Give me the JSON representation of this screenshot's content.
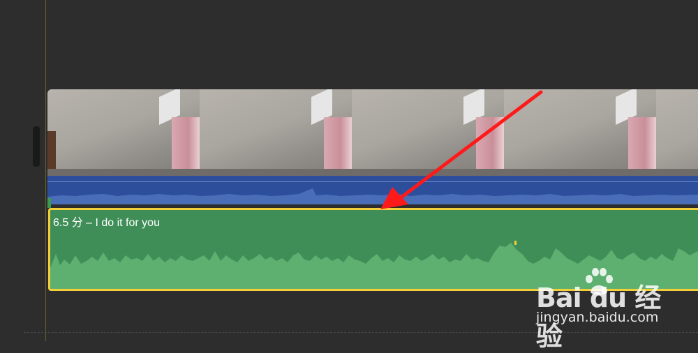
{
  "timeline": {
    "video_clip": {
      "thumbnail_count": 5
    },
    "music_clip": {
      "title": "6.5 分 – I do it for you",
      "selected": true
    }
  },
  "annotation": {
    "arrow_color": "#ff1a1a"
  },
  "watermark": {
    "logo": "Bai du 经验",
    "site": "jingyan.baidu.com"
  },
  "colors": {
    "background": "#2d2d2d",
    "video_audio": "#2d4f9b",
    "music_clip": "#3f8e58",
    "selection_border": "#f2cf3b"
  }
}
